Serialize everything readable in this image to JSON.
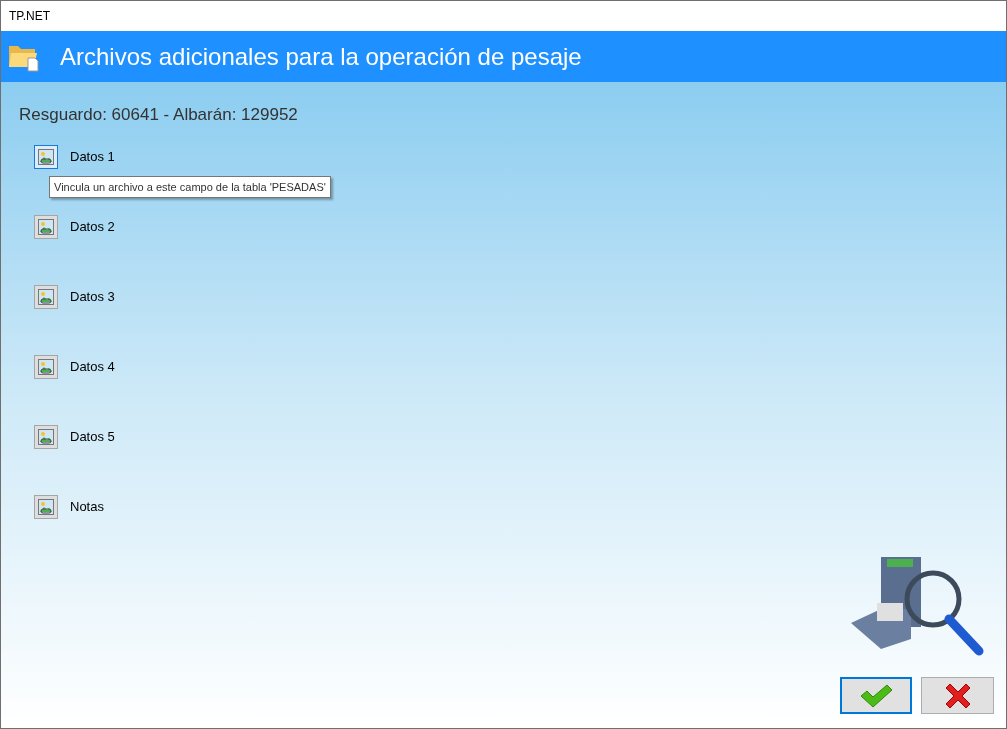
{
  "window": {
    "title": "TP.NET"
  },
  "header": {
    "title": "Archivos adicionales para la operación de pesaje"
  },
  "record_info": "Resguardo: 60641 - Albarán: 129952",
  "fields": [
    {
      "label": "Datos 1",
      "focused": true,
      "tooltip": "Vincula un archivo a este campo de la tabla 'PESADAS'"
    },
    {
      "label": "Datos 2",
      "focused": false
    },
    {
      "label": "Datos 3",
      "focused": false
    },
    {
      "label": "Datos 4",
      "focused": false
    },
    {
      "label": "Datos 5",
      "focused": false
    },
    {
      "label": "Notas",
      "focused": false
    }
  ],
  "buttons": [
    {
      "kind": "accept",
      "focused": true
    },
    {
      "kind": "cancel",
      "focused": false
    }
  ]
}
